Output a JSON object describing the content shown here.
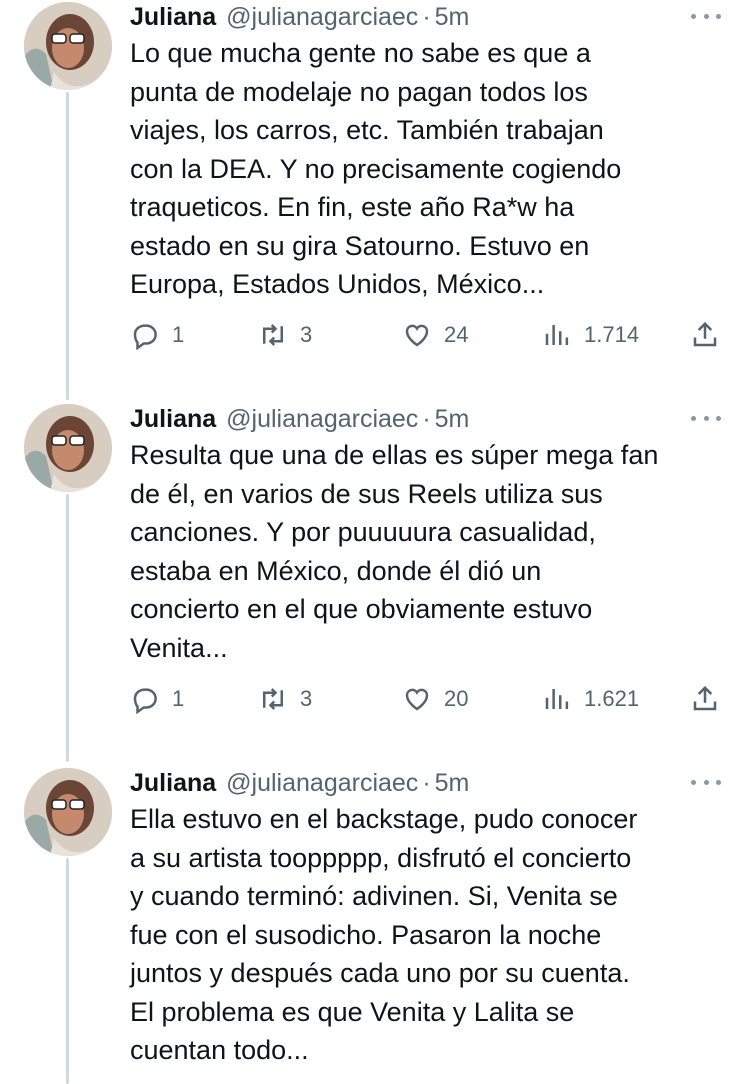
{
  "tweets": [
    {
      "name": "Juliana",
      "handle": "@julianagarciaec",
      "sep": "·",
      "time": "5m",
      "lines": [
        "Lo que mucha gente no sabe es que a",
        "punta de modelaje no pagan todos los",
        "viajes, los carros, etc. También trabajan",
        "con la DEA. Y no precisamente cogiendo",
        "traqueticos. En fin, este año Ra*w ha",
        "estado en su gira Satourno. Estuvo en",
        "Europa, Estados Unidos, México..."
      ],
      "replies": "1",
      "retweets": "3",
      "likes": "24",
      "views": "1.714"
    },
    {
      "name": "Juliana",
      "handle": "@julianagarciaec",
      "sep": "·",
      "time": "5m",
      "lines": [
        "Resulta que una de ellas es súper mega fan",
        "de él, en varios de sus Reels utiliza sus",
        "canciones. Y por puuuuura casualidad,",
        "estaba en México, donde él dió un",
        "concierto en el que obviamente estuvo",
        "Venita..."
      ],
      "replies": "1",
      "retweets": "3",
      "likes": "20",
      "views": "1.621"
    },
    {
      "name": "Juliana",
      "handle": "@julianagarciaec",
      "sep": "·",
      "time": "5m",
      "lines": [
        "Ella estuvo en el backstage, pudo conocer",
        "a su artista tooppppp, disfrutó el concierto",
        "y cuando terminó: adivinen. Si, Venita se",
        "fue con el susodicho. Pasaron la noche",
        "juntos y después cada uno por su cuenta.",
        "El problema es que Venita y Lalita se",
        "cuentan todo..."
      ]
    }
  ],
  "icons": {
    "reply": "reply-icon",
    "retweet": "retweet-icon",
    "like": "heart-icon",
    "views": "views-icon",
    "share": "share-icon",
    "more": "more-icon"
  },
  "colors": {
    "text": "#0f1419",
    "secondary": "#536471",
    "thread_line": "#cfd9de"
  }
}
